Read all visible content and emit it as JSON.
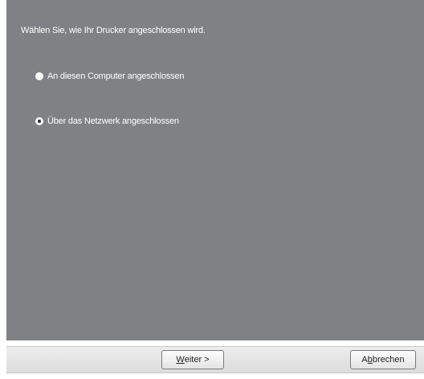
{
  "dialog": {
    "prompt": "Wählen Sie, wie Ihr Drucker angeschlossen wird.",
    "options": [
      {
        "label": "An diesen Computer angeschlossen",
        "selected": false
      },
      {
        "label": "Über das Netzwerk angeschlossen",
        "selected": true
      }
    ]
  },
  "footer": {
    "next_accel": "W",
    "next_rest": "eiter >",
    "cancel_pre": "A",
    "cancel_accel": "b",
    "cancel_rest": "brechen"
  },
  "colors": {
    "panel": "#808184",
    "text": "#ffffff"
  }
}
